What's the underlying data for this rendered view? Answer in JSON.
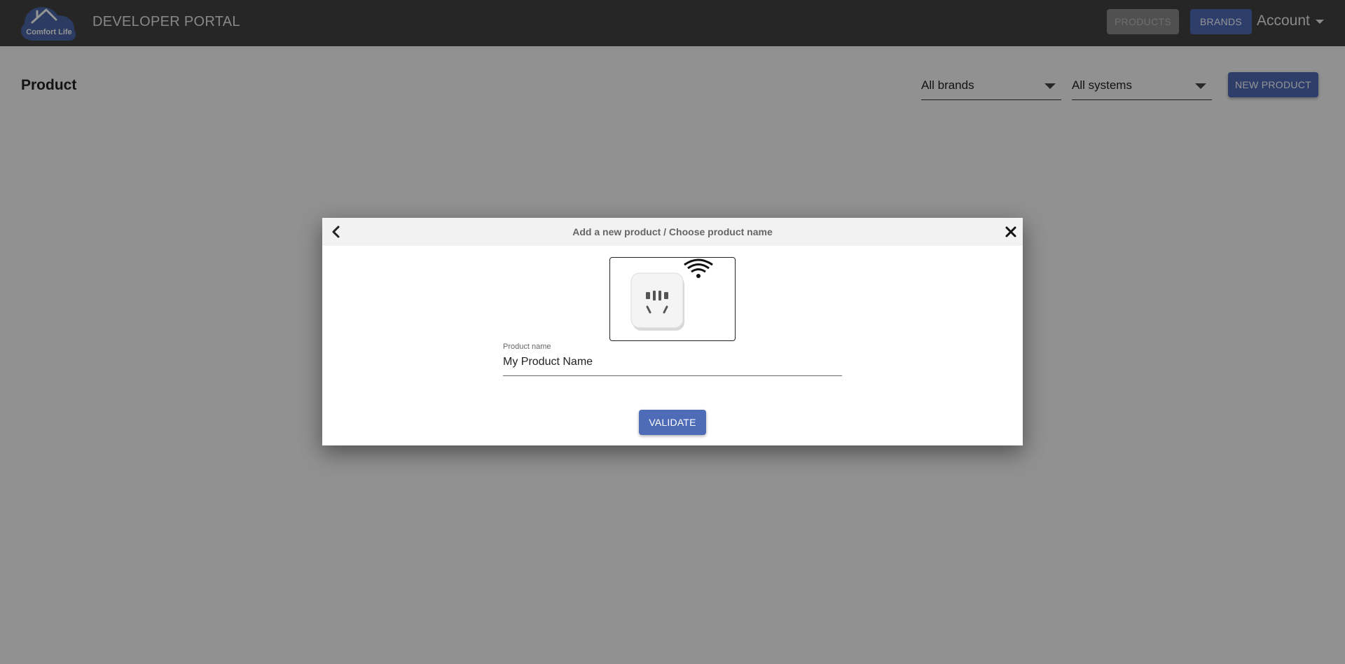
{
  "app": {
    "logo_text": "Comfort Life",
    "portal_title": "DEVELOPER PORTAL"
  },
  "nav": {
    "products_label": "PRODUCTS",
    "brands_label": "BRANDS",
    "account_label": "Account"
  },
  "page": {
    "title": "Product",
    "brand_filter": "All brands",
    "system_filter": "All systems",
    "new_product_label": "NEW PRODUCT"
  },
  "dialog": {
    "title": "Add a new product / Choose product name",
    "product_name_label": "Product name",
    "product_name_value": "My Product Name",
    "validate_label": "VALIDATE"
  },
  "icons": {
    "back": "chevron-left-icon",
    "close": "close-icon",
    "dropdown": "caret-down-icon",
    "wifi": "wifi-icon",
    "product": "smart-plug-image"
  },
  "colors": {
    "topbar": "#424242",
    "accent": "#4e6bb8",
    "disabled": "#8a8a8a"
  }
}
